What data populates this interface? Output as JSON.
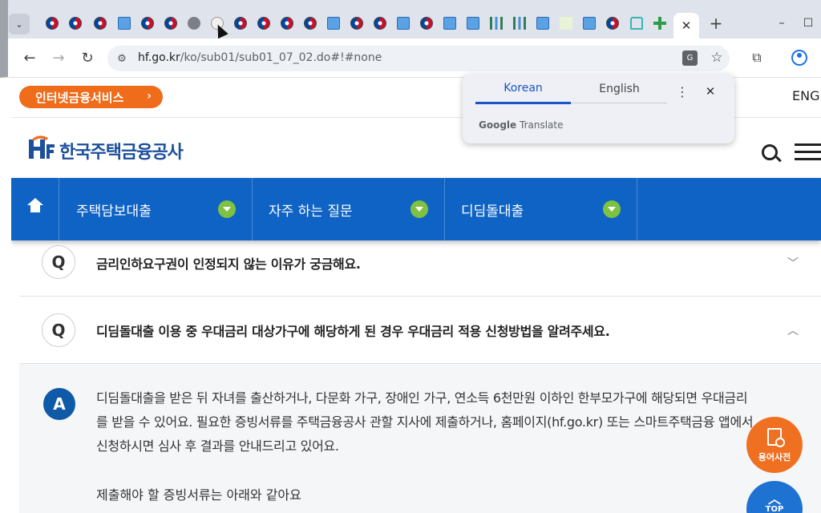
{
  "browser": {
    "url_host": "hf.go.kr",
    "url_path": "/ko/sub01/sub01_07_02.do#!#none",
    "active_tab_close": "✕",
    "new_tab_label": "+",
    "window_minimize": "–",
    "window_maximize": "☐",
    "window_close": "✕"
  },
  "translate_popup": {
    "tab_source": "Korean",
    "tab_target": "English",
    "brand_google": "Google",
    "brand_translate": "Translate"
  },
  "site": {
    "internet_banking_label": "인터넷금융서비스",
    "lang_link": "ENG",
    "logo_text": "한국주택금융공사",
    "nav": [
      "주택담보대출",
      "자주 하는 질문",
      "디딤돌대출"
    ]
  },
  "faq": {
    "q_mark": "Q",
    "a_mark": "A",
    "questions": [
      "금리인하요구권이 인정되지 않는 이유가 궁금해요.",
      "디딤돌대출 이용 중 우대금리 대상가구에 해당하게 된 경우 우대금리 적용 신청방법을 알려주세요."
    ],
    "answer_text": "디딤돌대출을 받은 뒤 자녀를 출산하거나, 다문화 가구, 장애인 가구, 연소득 6천만원 이하인 한부모가구에 해당되면 우대금리를 받을 수 있어요. 필요한 증빙서류를 주택금융공사 관할 지사에 제출하거나, 홈페이지(hf.go.kr) 또는 스마트주택금융 앱에서 신청하시면 심사 후 결과를 안내드리고 있어요.",
    "answer_sub": "제출해야 할 증빙서류는 아래와 같아요"
  },
  "floating": {
    "dictionary_label": "용어사전",
    "top_label": "TOP"
  },
  "colors": {
    "brand_blue": "#0f63c4",
    "accent_orange": "#ef6c1b",
    "nav_arrow_green": "#7fc241"
  }
}
